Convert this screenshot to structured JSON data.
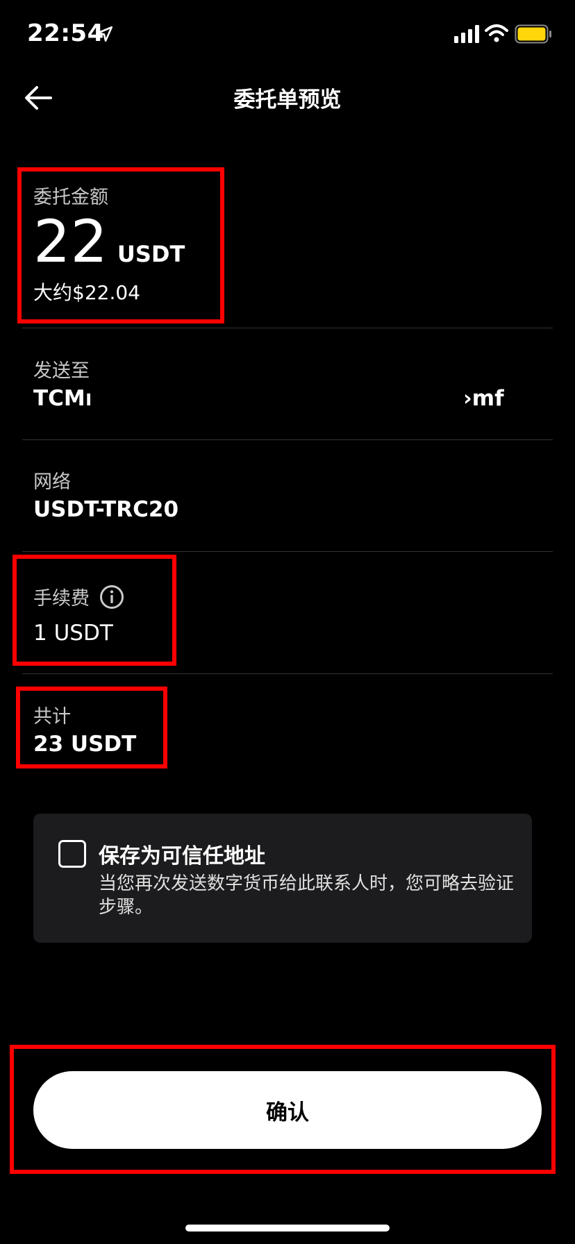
{
  "status_bar": {
    "time": "22:54",
    "battery_color": "#ffd60a"
  },
  "header": {
    "title": "委托单预览",
    "back_icon": "arrow-left-icon"
  },
  "amount": {
    "label": "委托金额",
    "value": "22",
    "unit": "USDT",
    "approx": "大约$22.04"
  },
  "send_to": {
    "label": "发送至",
    "address_start": "TCMr",
    "address_end": "›mf"
  },
  "network": {
    "label": "网络",
    "value": "USDT-TRC20"
  },
  "fee": {
    "label": "手续费",
    "value": "1 USDT",
    "info_icon": "info-icon"
  },
  "total": {
    "label": "共计",
    "value": "23 USDT"
  },
  "trusted_address": {
    "checked": false,
    "title": "保存为可信任地址",
    "description": "当您再次发送数字货币给此联系人时，您可略去验证步骤。"
  },
  "confirm": {
    "label": "确认"
  },
  "annotation": {
    "highlight_color": "#ff0000"
  }
}
